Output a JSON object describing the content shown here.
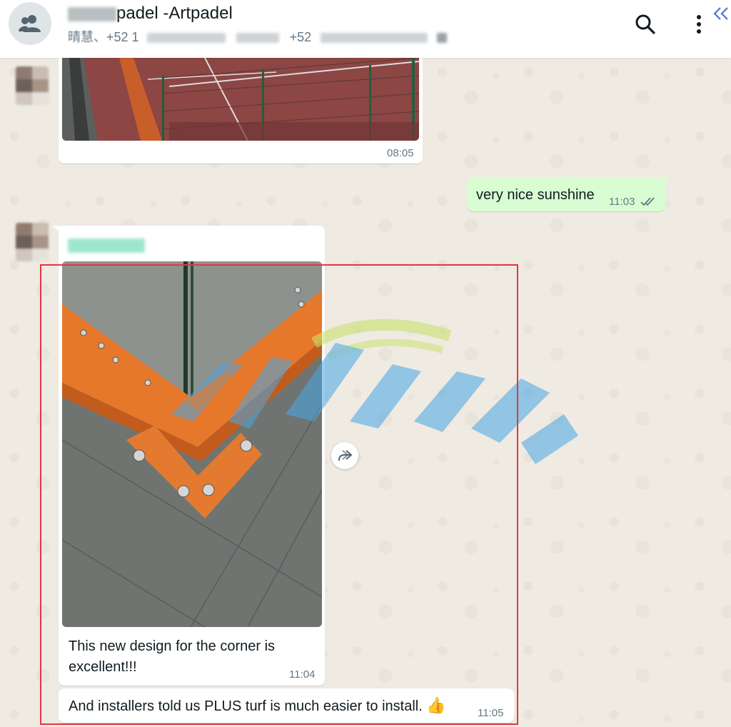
{
  "header": {
    "title": "padel -Artpadel",
    "subtitle_name": "晴慧、",
    "subtitle_phone_1": "+52 1",
    "subtitle_phone_2": "+52"
  },
  "messages": [
    {
      "id": "court-photo",
      "direction": "in",
      "type": "image",
      "time": "08:05"
    },
    {
      "id": "sunshine",
      "direction": "out",
      "text": "very nice sunshine",
      "time": "11:03",
      "status": "read"
    },
    {
      "id": "corner-photo",
      "direction": "in",
      "type": "image",
      "caption": "This new design for the corner is excellent!!!",
      "time": "11:04"
    },
    {
      "id": "installers",
      "direction": "in",
      "text": "And installers told us PLUS turf is much easier to install.",
      "emoji": "👍",
      "time": "11:05"
    }
  ],
  "colors": {
    "outgoing_bubble": "#d9fdd3",
    "incoming_bubble": "#ffffff",
    "highlight": "#e2373f",
    "chat_background": "#efeae2"
  },
  "icons": [
    "group-avatar-icon",
    "search-icon",
    "menu-icon",
    "collapse-icon",
    "forward-icon",
    "double-check-icon"
  ]
}
